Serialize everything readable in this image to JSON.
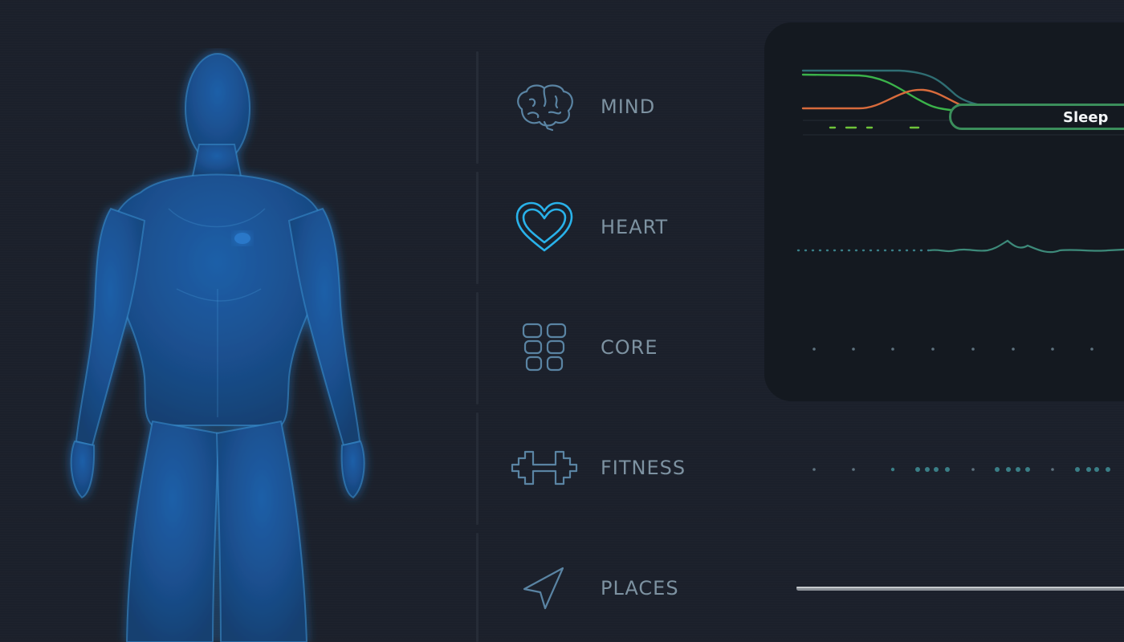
{
  "categories": [
    {
      "id": "mind",
      "label": "MIND",
      "icon": "brain-icon"
    },
    {
      "id": "heart",
      "label": "HEART",
      "icon": "heart-icon"
    },
    {
      "id": "core",
      "label": "CORE",
      "icon": "core-icon"
    },
    {
      "id": "fitness",
      "label": "FITNESS",
      "icon": "dumbbell-icon"
    },
    {
      "id": "places",
      "label": "PLACES",
      "icon": "location-arrow-icon"
    }
  ],
  "mind_panel": {
    "badge_label": "Sleep"
  },
  "colors": {
    "background": "#1b202b",
    "panel": "#141920",
    "label": "#7d92a1",
    "icon_stroke": "#5a84a3",
    "heart_active": "#29b2ea",
    "sleep_green": "#3b8e5b",
    "line_green": "#3bb34a",
    "line_orange": "#d86b3c",
    "line_teal": "#2f6e73",
    "dot_teal": "#3a7f87",
    "body_blue": "#1f6fb4"
  }
}
